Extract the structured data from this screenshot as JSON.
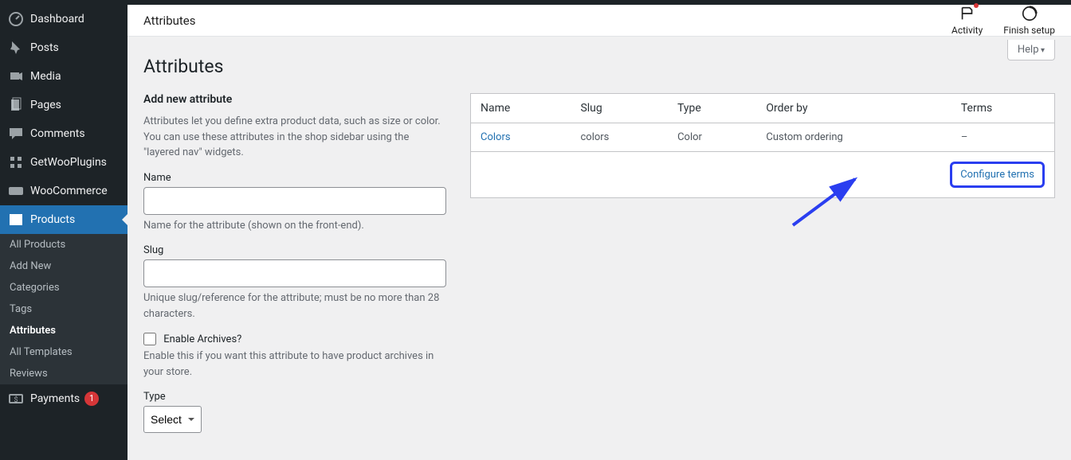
{
  "sidebar": {
    "items": [
      {
        "label": "Dashboard"
      },
      {
        "label": "Posts"
      },
      {
        "label": "Media"
      },
      {
        "label": "Pages"
      },
      {
        "label": "Comments"
      },
      {
        "label": "GetWooPlugins"
      },
      {
        "label": "WooCommerce"
      },
      {
        "label": "Products"
      },
      {
        "label": "Payments",
        "badge": "1"
      }
    ],
    "submenu": [
      {
        "label": "All Products"
      },
      {
        "label": "Add New"
      },
      {
        "label": "Categories"
      },
      {
        "label": "Tags"
      },
      {
        "label": "Attributes",
        "current": true
      },
      {
        "label": "All Templates"
      },
      {
        "label": "Reviews"
      }
    ]
  },
  "header": {
    "breadcrumb": "Attributes",
    "activity": "Activity",
    "finish": "Finish setup"
  },
  "page": {
    "help": "Help",
    "title": "Attributes",
    "add_heading": "Add new attribute",
    "intro": "Attributes let you define extra product data, such as size or color. You can use these attributes in the shop sidebar using the \"layered nav\" widgets.",
    "name_label": "Name",
    "name_desc": "Name for the attribute (shown on the front-end).",
    "slug_label": "Slug",
    "slug_desc": "Unique slug/reference for the attribute; must be no more than 28 characters.",
    "archives_label": "Enable Archives?",
    "archives_desc": "Enable this if you want this attribute to have product archives in your store.",
    "type_label": "Type",
    "type_value": "Select"
  },
  "table": {
    "headers": {
      "name": "Name",
      "slug": "Slug",
      "type": "Type",
      "order": "Order by",
      "terms": "Terms"
    },
    "row": {
      "name": "Colors",
      "slug": "colors",
      "type": "Color",
      "order": "Custom ordering",
      "terms": "–"
    },
    "configure": "Configure terms"
  }
}
